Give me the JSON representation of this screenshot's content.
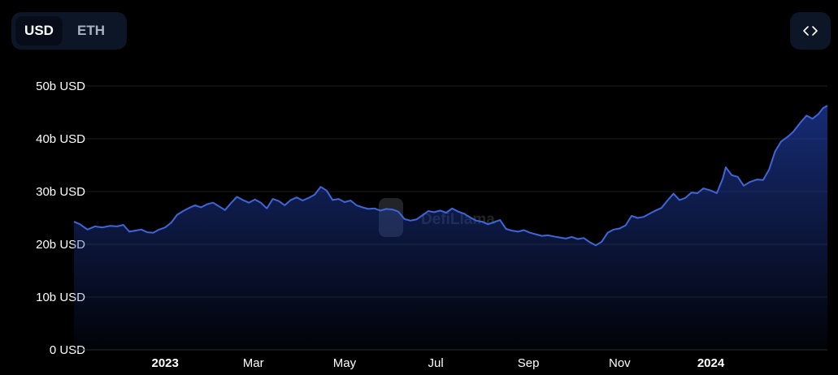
{
  "toggle": {
    "active_label": "USD",
    "inactive_label": "ETH"
  },
  "embed_icon": "code-brackets-icon",
  "watermark": {
    "text": "DefiLlama",
    "icon": "llama-logo"
  },
  "colors": {
    "line": "#3f66d8",
    "fill_top": "#1e3a9c",
    "background": "#000000",
    "grid": "#1c1c1c"
  },
  "chart_data": {
    "type": "area",
    "title": "",
    "xlabel": "",
    "ylabel": "",
    "unit": "USD",
    "ylim": [
      0,
      50
    ],
    "yticks": [
      {
        "value": 0,
        "label": "0 USD"
      },
      {
        "value": 10,
        "label": "10b USD"
      },
      {
        "value": 20,
        "label": "20b USD"
      },
      {
        "value": 30,
        "label": "30b USD"
      },
      {
        "value": 40,
        "label": "40b USD"
      },
      {
        "value": 50,
        "label": "50b USD"
      }
    ],
    "xlim": [
      "2022-11-01",
      "2024-03-19"
    ],
    "xticks": [
      {
        "date": "2023-01-01",
        "label": "2023",
        "bold": true
      },
      {
        "date": "2023-03-01",
        "label": "Mar",
        "bold": false
      },
      {
        "date": "2023-05-01",
        "label": "May",
        "bold": false
      },
      {
        "date": "2023-07-01",
        "label": "Jul",
        "bold": false
      },
      {
        "date": "2023-09-01",
        "label": "Sep",
        "bold": false
      },
      {
        "date": "2023-11-01",
        "label": "Nov",
        "bold": false
      },
      {
        "date": "2024-01-01",
        "label": "2024",
        "bold": true
      }
    ],
    "grid": true,
    "series": [
      {
        "values": [
          [
            "2022-11-01",
            24.3
          ],
          [
            "2022-11-05",
            23.8
          ],
          [
            "2022-11-10",
            22.8
          ],
          [
            "2022-11-15",
            23.4
          ],
          [
            "2022-11-20",
            23.2
          ],
          [
            "2022-11-25",
            23.5
          ],
          [
            "2022-11-30",
            23.4
          ],
          [
            "2022-12-04",
            23.7
          ],
          [
            "2022-12-08",
            22.4
          ],
          [
            "2022-12-12",
            22.6
          ],
          [
            "2022-12-16",
            22.8
          ],
          [
            "2022-12-20",
            22.3
          ],
          [
            "2022-12-24",
            22.2
          ],
          [
            "2022-12-28",
            22.8
          ],
          [
            "2023-01-01",
            23.2
          ],
          [
            "2023-01-05",
            24.1
          ],
          [
            "2023-01-09",
            25.6
          ],
          [
            "2023-01-13",
            26.3
          ],
          [
            "2023-01-17",
            26.9
          ],
          [
            "2023-01-21",
            27.4
          ],
          [
            "2023-01-25",
            27.0
          ],
          [
            "2023-01-29",
            27.6
          ],
          [
            "2023-02-02",
            27.9
          ],
          [
            "2023-02-06",
            27.2
          ],
          [
            "2023-02-10",
            26.5
          ],
          [
            "2023-02-14",
            27.8
          ],
          [
            "2023-02-18",
            29.0
          ],
          [
            "2023-02-22",
            28.4
          ],
          [
            "2023-02-26",
            27.9
          ],
          [
            "2023-03-02",
            28.5
          ],
          [
            "2023-03-06",
            27.9
          ],
          [
            "2023-03-10",
            26.8
          ],
          [
            "2023-03-14",
            28.6
          ],
          [
            "2023-03-18",
            28.2
          ],
          [
            "2023-03-22",
            27.4
          ],
          [
            "2023-03-26",
            28.4
          ],
          [
            "2023-03-30",
            28.9
          ],
          [
            "2023-04-03",
            28.3
          ],
          [
            "2023-04-07",
            28.8
          ],
          [
            "2023-04-11",
            29.4
          ],
          [
            "2023-04-15",
            30.9
          ],
          [
            "2023-04-19",
            30.2
          ],
          [
            "2023-04-23",
            28.4
          ],
          [
            "2023-04-27",
            28.6
          ],
          [
            "2023-05-01",
            28.0
          ],
          [
            "2023-05-05",
            28.3
          ],
          [
            "2023-05-09",
            27.4
          ],
          [
            "2023-05-13",
            27.0
          ],
          [
            "2023-05-17",
            26.7
          ],
          [
            "2023-05-21",
            26.8
          ],
          [
            "2023-05-25",
            26.4
          ],
          [
            "2023-05-29",
            26.7
          ],
          [
            "2023-06-02",
            26.6
          ],
          [
            "2023-06-06",
            26.2
          ],
          [
            "2023-06-10",
            24.8
          ],
          [
            "2023-06-14",
            24.5
          ],
          [
            "2023-06-18",
            24.7
          ],
          [
            "2023-06-22",
            25.5
          ],
          [
            "2023-06-26",
            26.3
          ],
          [
            "2023-06-30",
            26.1
          ],
          [
            "2023-07-04",
            26.4
          ],
          [
            "2023-07-08",
            26.0
          ],
          [
            "2023-07-12",
            26.8
          ],
          [
            "2023-07-16",
            26.2
          ],
          [
            "2023-07-20",
            25.8
          ],
          [
            "2023-07-24",
            25.1
          ],
          [
            "2023-07-28",
            24.5
          ],
          [
            "2023-08-01",
            24.3
          ],
          [
            "2023-08-05",
            23.8
          ],
          [
            "2023-08-09",
            24.2
          ],
          [
            "2023-08-13",
            24.6
          ],
          [
            "2023-08-17",
            22.9
          ],
          [
            "2023-08-21",
            22.6
          ],
          [
            "2023-08-25",
            22.4
          ],
          [
            "2023-08-29",
            22.7
          ],
          [
            "2023-09-02",
            22.2
          ],
          [
            "2023-09-06",
            21.9
          ],
          [
            "2023-09-10",
            21.6
          ],
          [
            "2023-09-14",
            21.7
          ],
          [
            "2023-09-18",
            21.5
          ],
          [
            "2023-09-22",
            21.3
          ],
          [
            "2023-09-26",
            21.1
          ],
          [
            "2023-09-30",
            21.4
          ],
          [
            "2023-10-04",
            21.0
          ],
          [
            "2023-10-08",
            21.2
          ],
          [
            "2023-10-12",
            20.4
          ],
          [
            "2023-10-16",
            19.8
          ],
          [
            "2023-10-20",
            20.5
          ],
          [
            "2023-10-24",
            22.2
          ],
          [
            "2023-10-28",
            22.8
          ],
          [
            "2023-11-01",
            23.0
          ],
          [
            "2023-11-05",
            23.6
          ],
          [
            "2023-11-09",
            25.4
          ],
          [
            "2023-11-13",
            25.0
          ],
          [
            "2023-11-17",
            25.2
          ],
          [
            "2023-11-21",
            25.8
          ],
          [
            "2023-11-25",
            26.4
          ],
          [
            "2023-11-29",
            26.9
          ],
          [
            "2023-12-03",
            28.3
          ],
          [
            "2023-12-07",
            29.6
          ],
          [
            "2023-12-11",
            28.4
          ],
          [
            "2023-12-15",
            28.8
          ],
          [
            "2023-12-19",
            29.8
          ],
          [
            "2023-12-23",
            29.7
          ],
          [
            "2023-12-27",
            30.6
          ],
          [
            "2024-01-01",
            30.2
          ],
          [
            "2024-01-05",
            29.7
          ],
          [
            "2024-01-09",
            32.5
          ],
          [
            "2024-01-11",
            34.6
          ],
          [
            "2024-01-15",
            33.1
          ],
          [
            "2024-01-19",
            32.8
          ],
          [
            "2024-01-23",
            31.1
          ],
          [
            "2024-01-27",
            31.8
          ],
          [
            "2024-02-01",
            32.3
          ],
          [
            "2024-02-05",
            32.2
          ],
          [
            "2024-02-09",
            34.2
          ],
          [
            "2024-02-13",
            37.6
          ],
          [
            "2024-02-17",
            39.5
          ],
          [
            "2024-02-21",
            40.3
          ],
          [
            "2024-02-25",
            41.3
          ],
          [
            "2024-03-01",
            43.1
          ],
          [
            "2024-03-05",
            44.4
          ],
          [
            "2024-03-09",
            43.8
          ],
          [
            "2024-03-13",
            44.7
          ],
          [
            "2024-03-16",
            45.8
          ],
          [
            "2024-03-19",
            46.3
          ]
        ]
      }
    ]
  }
}
